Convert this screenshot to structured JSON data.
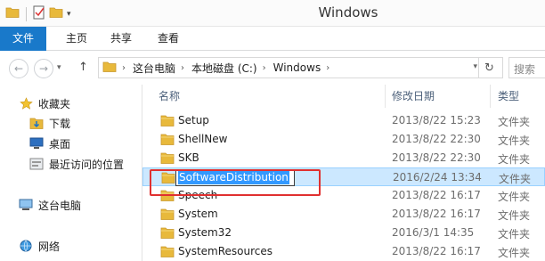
{
  "window": {
    "title": "Windows"
  },
  "ribbon": {
    "tabs": [
      {
        "label": "文件"
      },
      {
        "label": "主页"
      },
      {
        "label": "共享"
      },
      {
        "label": "查看"
      }
    ],
    "accent": "#1979ca"
  },
  "address": {
    "crumbs": [
      "这台电脑",
      "本地磁盘 (C:)",
      "Windows"
    ],
    "search_placeholder": "搜索"
  },
  "nav": {
    "favorites": {
      "label": "收藏夹",
      "icon": "star-icon"
    },
    "items": [
      {
        "label": "下载",
        "icon": "download-folder-icon"
      },
      {
        "label": "桌面",
        "icon": "desktop-icon"
      },
      {
        "label": "最近访问的位置",
        "icon": "recent-places-icon"
      }
    ],
    "thispc": {
      "label": "这台电脑",
      "icon": "computer-icon"
    },
    "network": {
      "label": "网络",
      "icon": "network-icon"
    }
  },
  "columns": {
    "name": "名称",
    "date": "修改日期",
    "type": "类型"
  },
  "files": [
    {
      "name": "Setup",
      "date": "2013/8/22 15:23",
      "type": "文件夹"
    },
    {
      "name": "ShellNew",
      "date": "2013/8/22 22:30",
      "type": "文件夹"
    },
    {
      "name": "SKB",
      "date": "2013/8/22 22:30",
      "type": "文件夹"
    },
    {
      "name": "SoftwareDistribution",
      "date": "2016/2/24 13:34",
      "type": "文件夹",
      "selected": true,
      "renaming": true
    },
    {
      "name": "Speech",
      "date": "2013/8/22 16:17",
      "type": "文件夹"
    },
    {
      "name": "System",
      "date": "2013/8/22 16:17",
      "type": "文件夹"
    },
    {
      "name": "System32",
      "date": "2016/3/1 14:35",
      "type": "文件夹"
    },
    {
      "name": "SystemResources",
      "date": "2013/8/22 16:17",
      "type": "文件夹"
    }
  ]
}
